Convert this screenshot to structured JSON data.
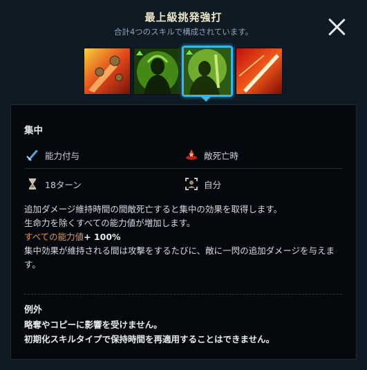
{
  "header": {
    "title": "最上級挑発強打",
    "subtitle": "合計4つのスキルで構成されています。"
  },
  "skills": [
    {
      "icon": "fire-flail-skill-icon",
      "selected": false
    },
    {
      "icon": "green-aura-warrior-skill-icon",
      "selected": false
    },
    {
      "icon": "green-warrior-focus-skill-icon",
      "selected": true
    },
    {
      "icon": "red-slash-skill-icon",
      "selected": false
    }
  ],
  "detail": {
    "name": "集中",
    "stats": {
      "type": "能力付与",
      "trigger": "敵死亡時",
      "duration": "18ターン",
      "target": "自分"
    },
    "description": {
      "line1": "追加ダメージ維持時間の間敵死亡すると集中の効果を取得します。",
      "line2": "生命力を除くすべての能力値が増加します。",
      "line3_label": "すべての能力値",
      "line3_value": "+ 100%",
      "line4": "集中効果が維持される間は攻撃をするたびに、敵に一閃の追加ダメージを与えます。"
    },
    "exceptions": {
      "title": "例外",
      "line1": "略奪やコピーに影響を受けません。",
      "line2": "初期化スキルタイプで保持時間を再適用することはできません。"
    }
  },
  "colors": {
    "accent": "#38b6e6",
    "highlight": "#e8944a"
  }
}
